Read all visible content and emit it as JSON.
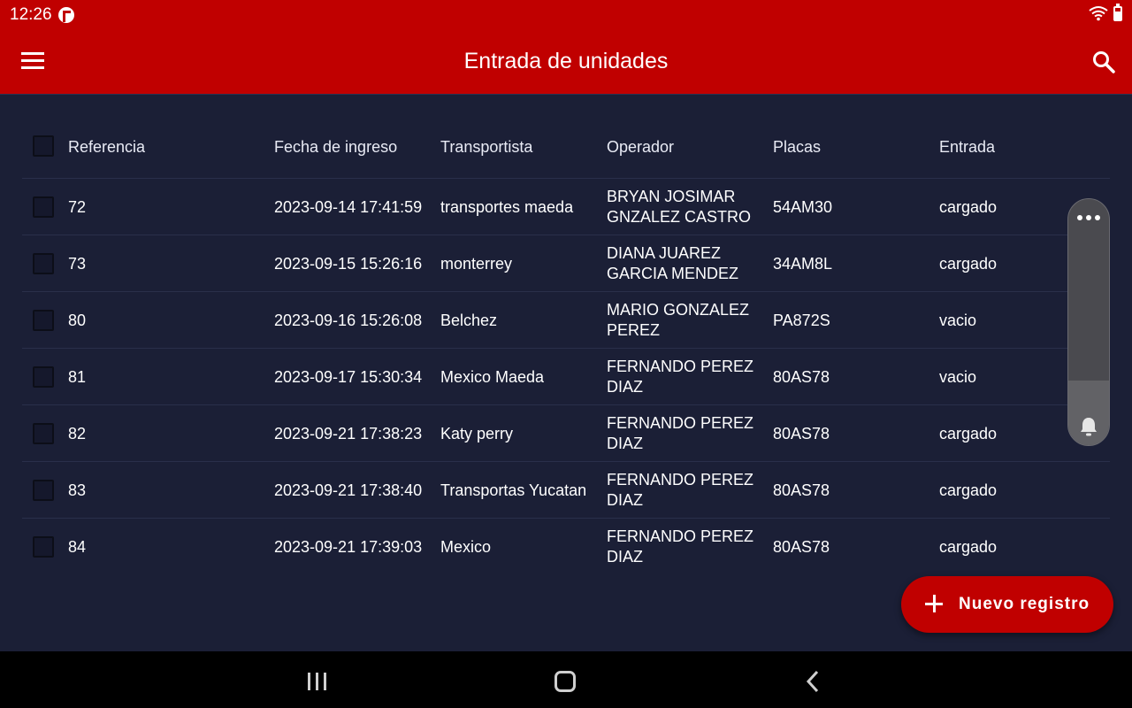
{
  "status_bar": {
    "time": "12:26"
  },
  "app_bar": {
    "title": "Entrada de unidades"
  },
  "table": {
    "columns": [
      "Referencia",
      "Fecha de ingreso",
      "Transportista",
      "Operador",
      "Placas",
      "Entrada"
    ],
    "rows": [
      {
        "referencia": "72",
        "fecha": "2023-09-14 17:41:59",
        "transportista": "transportes maeda",
        "operador": [
          "BRYAN JOSIMAR",
          "GNZALEZ CASTRO"
        ],
        "placas": "54AM30",
        "entrada": "cargado"
      },
      {
        "referencia": "73",
        "fecha": "2023-09-15 15:26:16",
        "transportista": "monterrey",
        "operador": [
          "DIANA JUAREZ",
          "GARCIA MENDEZ"
        ],
        "placas": "34AM8L",
        "entrada": "cargado"
      },
      {
        "referencia": "80",
        "fecha": "2023-09-16 15:26:08",
        "transportista": "Belchez",
        "operador": [
          "MARIO GONZALEZ",
          "PEREZ"
        ],
        "placas": "PA872S",
        "entrada": "vacio"
      },
      {
        "referencia": "81",
        "fecha": "2023-09-17 15:30:34",
        "transportista": "Mexico Maeda",
        "operador": [
          "FERNANDO PEREZ",
          "DIAZ"
        ],
        "placas": "80AS78",
        "entrada": "vacio"
      },
      {
        "referencia": "82",
        "fecha": "2023-09-21 17:38:23",
        "transportista": "Katy perry",
        "operador": [
          "FERNANDO PEREZ",
          "DIAZ"
        ],
        "placas": "80AS78",
        "entrada": "cargado"
      },
      {
        "referencia": "83",
        "fecha": "2023-09-21 17:38:40",
        "transportista": "Transportas Yucatan",
        "operador": [
          "FERNANDO PEREZ",
          "DIAZ"
        ],
        "placas": "80AS78",
        "entrada": "cargado"
      },
      {
        "referencia": "84",
        "fecha": "2023-09-21 17:39:03",
        "transportista": "Mexico",
        "operador": [
          "FERNANDO PEREZ",
          "DIAZ"
        ],
        "placas": "80AS78",
        "entrada": "cargado"
      }
    ]
  },
  "fab": {
    "label": "Nuevo registro"
  },
  "colors": {
    "brand_red": "#c00000",
    "background": "#1b1f36"
  },
  "icons": {
    "menu": "menu-icon",
    "search": "search-icon",
    "more": "more-horizontal-icon",
    "bell": "bell-icon",
    "add": "plus-icon"
  }
}
